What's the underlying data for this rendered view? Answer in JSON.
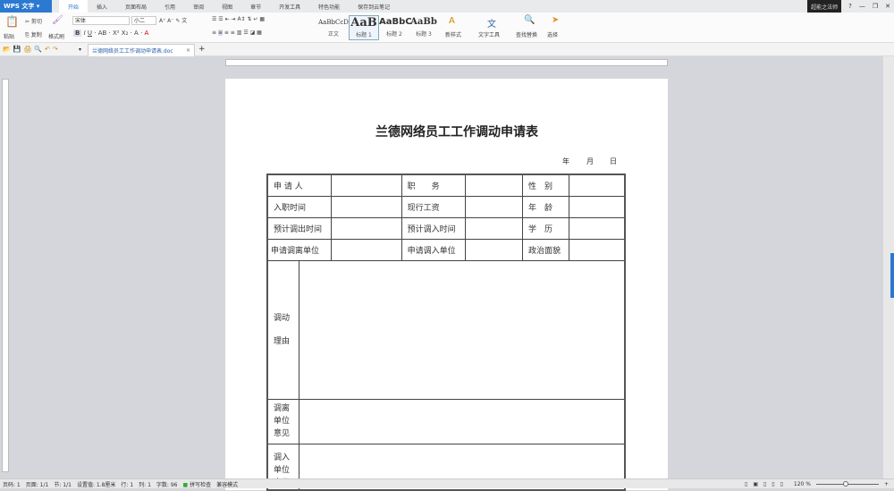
{
  "app": {
    "name": "WPS 文字",
    "user": "超能之法师"
  },
  "menu_tabs": [
    "开始",
    "插入",
    "页面布局",
    "引用",
    "审阅",
    "视图",
    "章节",
    "开发工具",
    "特色功能",
    "保存到云笔记"
  ],
  "ribbon": {
    "paste": "粘贴",
    "cut": "剪切",
    "copy": "复制",
    "format_painter": "格式刷",
    "font": "宋体",
    "size": "小二",
    "styles": [
      {
        "sample": "AaBbCcD",
        "label": "正文"
      },
      {
        "sample": "AaB",
        "label": "标题 1"
      },
      {
        "sample": "AaBbC",
        "label": "标题 2"
      },
      {
        "sample": "AaBb",
        "label": "标题 3"
      }
    ],
    "new_style": "新样式",
    "text_tools": "文字工具",
    "find_replace": "查找替换",
    "select": "选择"
  },
  "document_tab": "兰德网络员工工作调动申请表.doc",
  "doc": {
    "title": "兰德网络员工工作调动申请表",
    "date": [
      "年",
      "月",
      "日"
    ],
    "rows": [
      [
        "申 请 人",
        "职　　务",
        "性　别"
      ],
      [
        "入职时间",
        "现行工资",
        "年　龄"
      ],
      [
        "预计调出时间",
        "预计调入时间",
        "学　历"
      ],
      [
        "申请调离单位",
        "申请调入单位",
        "政治面貌"
      ]
    ],
    "reason": [
      "调动",
      "理由"
    ],
    "out_opinion": "调离单位意见",
    "in_opinion": "调入单位意见"
  },
  "status": {
    "page": "页码: 1",
    "pages": "页面: 1/1",
    "section": "节: 1/1",
    "setting": "设置值: 1.8厘米",
    "row": "行: 1",
    "col": "列: 1",
    "words": "字数: 96",
    "spell": "拼写检查",
    "mode": "兼容模式",
    "zoom": "120 %"
  }
}
